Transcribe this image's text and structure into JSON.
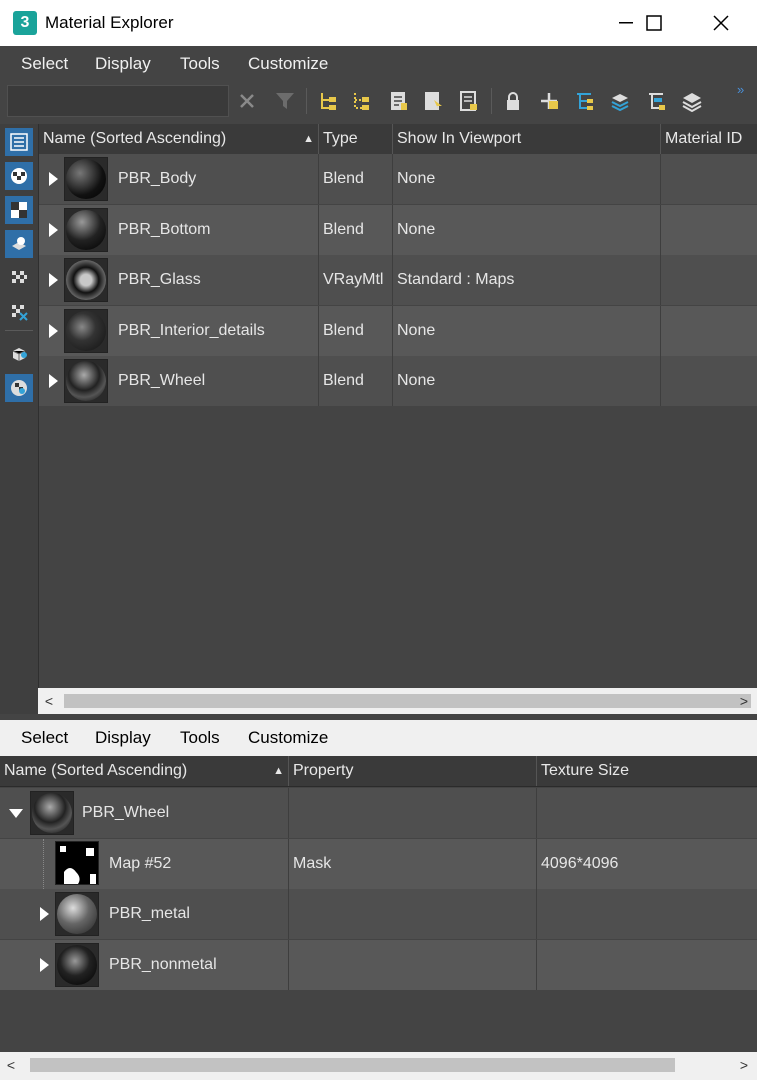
{
  "window": {
    "app_icon_label": "3",
    "title": "Material Explorer"
  },
  "menu": {
    "items": [
      "Select",
      "Display",
      "Tools",
      "Customize"
    ]
  },
  "search": {
    "value": "",
    "placeholder": ""
  },
  "upper_table": {
    "headers": [
      "Name (Sorted Ascending)",
      "Type",
      "Show In Viewport",
      "Material ID"
    ],
    "rows": [
      {
        "name": "PBR_Body",
        "type": "Blend",
        "viewport": "None",
        "material_id": ""
      },
      {
        "name": "PBR_Bottom",
        "type": "Blend",
        "viewport": "None",
        "material_id": ""
      },
      {
        "name": "PBR_Glass",
        "type": "VRayMtl",
        "viewport": "Standard : Maps",
        "material_id": ""
      },
      {
        "name": "PBR_Interior_details",
        "type": "Blend",
        "viewport": "None",
        "material_id": ""
      },
      {
        "name": "PBR_Wheel",
        "type": "Blend",
        "viewport": "None",
        "material_id": ""
      }
    ]
  },
  "lower_menu": {
    "items": [
      "Select",
      "Display",
      "Tools",
      "Customize"
    ]
  },
  "lower_table": {
    "headers": [
      "Name (Sorted Ascending)",
      "Property",
      "Texture Size"
    ],
    "rows": [
      {
        "name": "PBR_Wheel",
        "property": "",
        "texture_size": ""
      },
      {
        "name": "Map #52",
        "property": "Mask",
        "texture_size": "4096*4096"
      },
      {
        "name": "PBR_metal",
        "property": "",
        "texture_size": ""
      },
      {
        "name": "PBR_nonmetal",
        "property": "",
        "texture_size": ""
      }
    ]
  },
  "colors": {
    "accent": "#2f6fa8",
    "toolbar_icon": "#e8c84a",
    "teal_icon": "#1aa39a"
  }
}
